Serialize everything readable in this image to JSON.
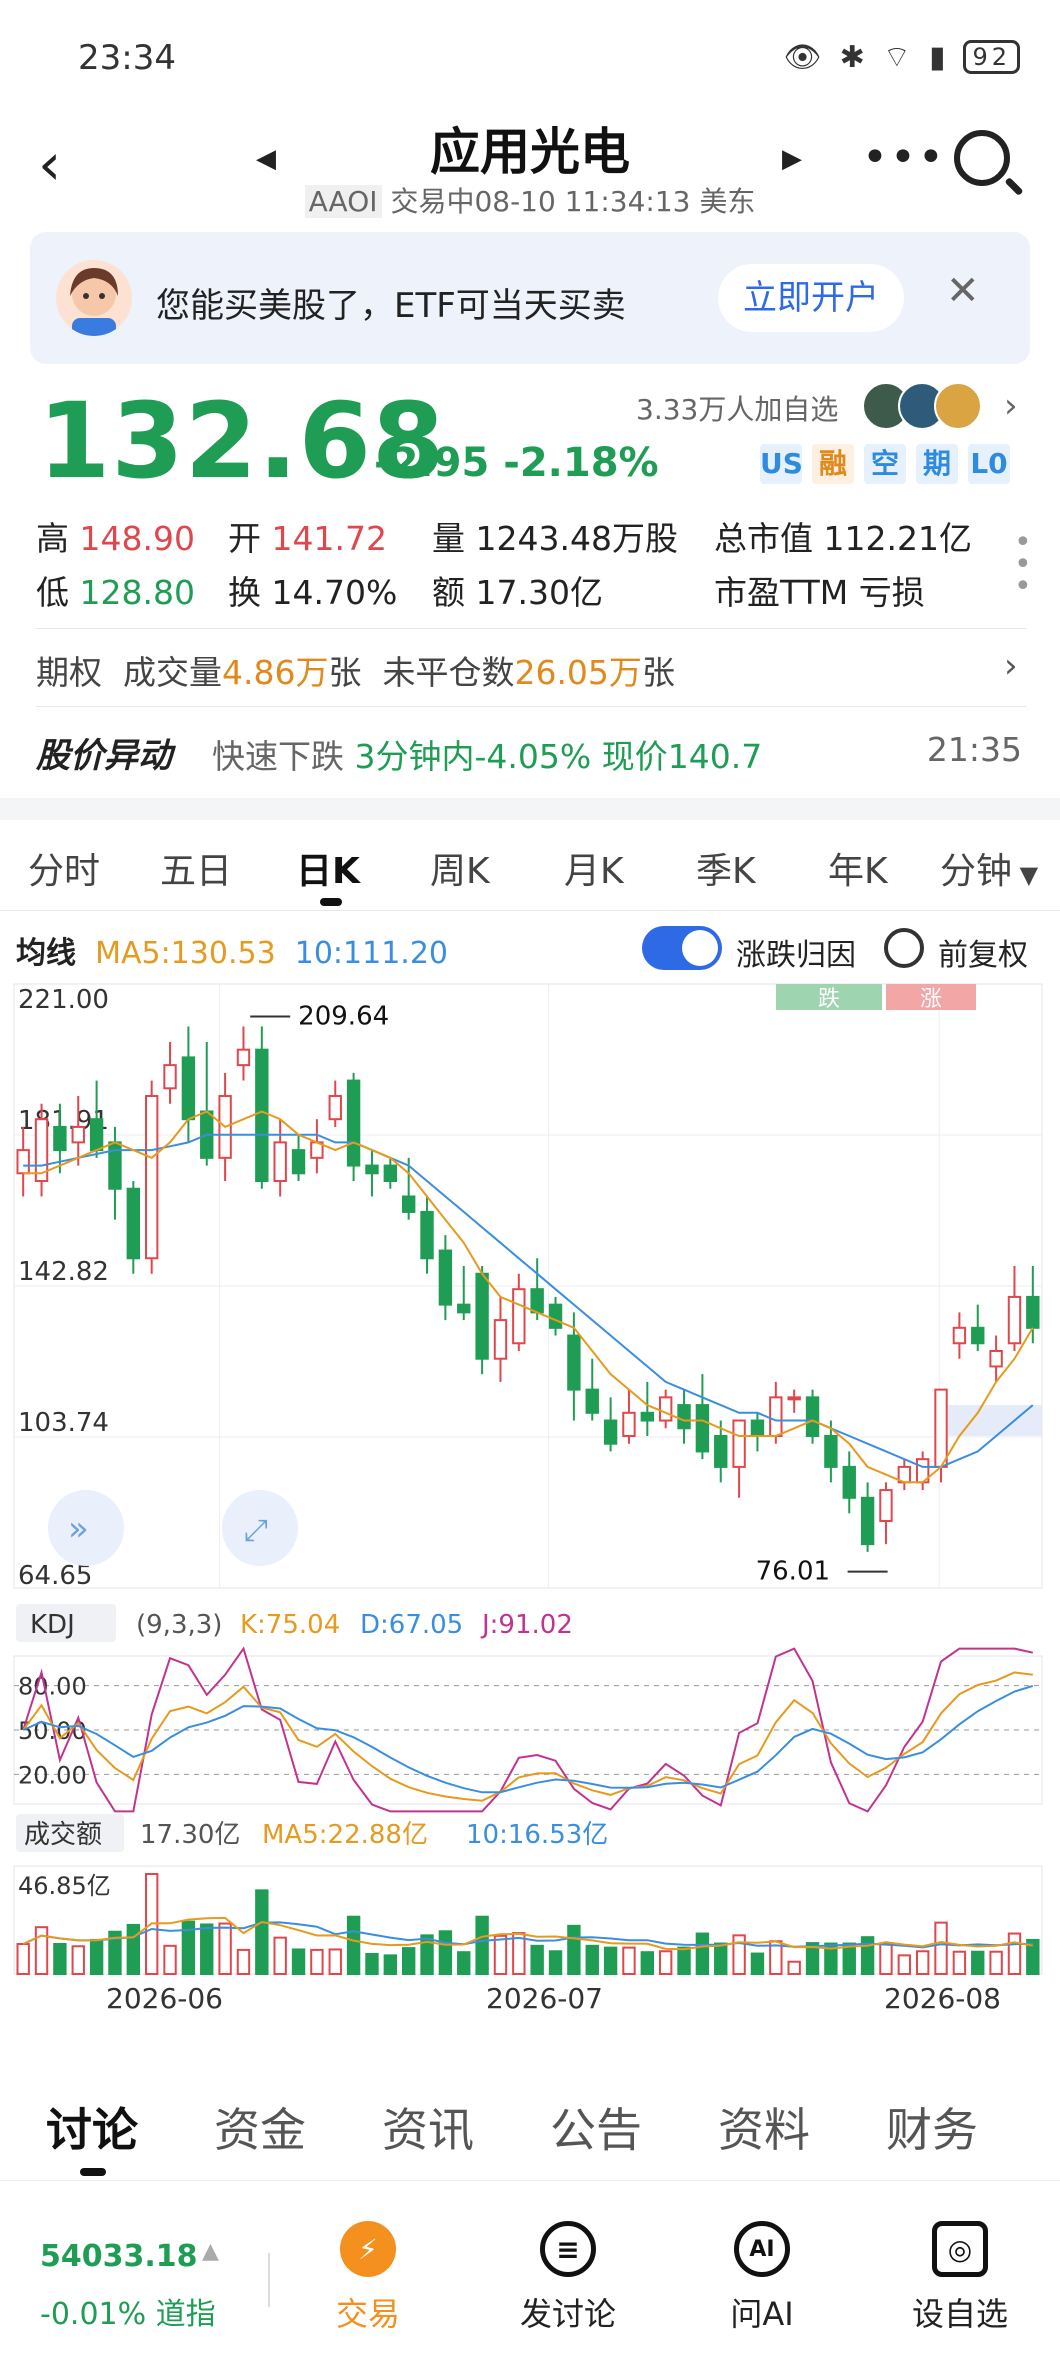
{
  "status": {
    "time": "23:34",
    "battery": "92",
    "icons": [
      "shield-icon",
      "eye-icon",
      "alarm-icon",
      "bluetooth-icon",
      "vibrate-icon",
      "wifi-icon",
      "hd-icon",
      "signal-icon"
    ]
  },
  "header": {
    "title": "应用光电",
    "ticker": "AAOI",
    "status_line": "交易中08-10 11:34:13 美东"
  },
  "banner": {
    "text": "您能买美股了，ETF可当天买卖",
    "button": "立即开户"
  },
  "quote": {
    "price": "132.68",
    "change": "-2.95",
    "change_pct": "-2.18%",
    "watch_count": "3.33万人加自选",
    "tags": [
      "US",
      "融",
      "空",
      "期",
      "L0"
    ],
    "high_label": "高",
    "high": "148.90",
    "open_label": "开",
    "open": "141.72",
    "volume_label": "量",
    "volume": "1243.48万股",
    "mcap_label": "总市值",
    "mcap": "112.21亿",
    "low_label": "低",
    "low": "128.80",
    "turnover_label": "换",
    "turnover": "14.70%",
    "amount_label": "额",
    "amount": "17.30亿",
    "pe_label": "市盈TTM",
    "pe": "亏损"
  },
  "options": {
    "label": "期权",
    "vol_label": "成交量",
    "vol": "4.86万",
    "vol_unit": "张",
    "oi_label": "未平仓数",
    "oi": "26.05万",
    "oi_unit": "张"
  },
  "alert": {
    "title": "股价异动",
    "type": "快速下跌",
    "detail": "3分钟内-4.05%",
    "price_text": "现价140.7",
    "time": "21:35"
  },
  "period_tabs": [
    "分时",
    "五日",
    "日K",
    "周K",
    "月K",
    "季K",
    "年K",
    "分钟"
  ],
  "ma": {
    "label": "均线",
    "ma5": "MA5:130.53",
    "ma10": "10:111.20"
  },
  "toggle_label": "涨跌归因",
  "fq_label": "前复权",
  "chart_data": {
    "type": "candlestick",
    "ylim": [
      64.65,
      221.0
    ],
    "y_ticks": [
      "221.00",
      "181.91",
      "142.82",
      "103.74",
      "64.65"
    ],
    "x_labels": [
      "2026-06",
      "2026-07",
      "2026-08"
    ],
    "annotations": {
      "high": "209.64",
      "low": "76.01"
    },
    "legend_badges": [
      "跌",
      "涨"
    ],
    "candles": [
      [
        172,
        178,
        166,
        184
      ],
      [
        170,
        186,
        166,
        190
      ],
      [
        184,
        178,
        172,
        190
      ],
      [
        180,
        184,
        174,
        192
      ],
      [
        186,
        178,
        176,
        196
      ],
      [
        180,
        168,
        160,
        184
      ],
      [
        168,
        150,
        146,
        170
      ],
      [
        150,
        192,
        146,
        196
      ],
      [
        194,
        200,
        190,
        206
      ],
      [
        202,
        186,
        180,
        210
      ],
      [
        188,
        176,
        174,
        206
      ],
      [
        176,
        192,
        170,
        198
      ],
      [
        200,
        204,
        196,
        210
      ],
      [
        204,
        170,
        168,
        210
      ],
      [
        170,
        180,
        166,
        186
      ],
      [
        178,
        172,
        170,
        182
      ],
      [
        176,
        180,
        172,
        186
      ],
      [
        186,
        192,
        184,
        196
      ],
      [
        196,
        174,
        170,
        198
      ],
      [
        174,
        172,
        166,
        178
      ],
      [
        174,
        170,
        168,
        176
      ],
      [
        166,
        162,
        160,
        176
      ],
      [
        162,
        150,
        146,
        166
      ],
      [
        152,
        138,
        134,
        156
      ],
      [
        138,
        136,
        134,
        148
      ],
      [
        146,
        124,
        120,
        148
      ],
      [
        124,
        134,
        118,
        140
      ],
      [
        128,
        142,
        126,
        146
      ],
      [
        142,
        136,
        134,
        150
      ],
      [
        138,
        132,
        130,
        140
      ],
      [
        130,
        116,
        108,
        136
      ],
      [
        116,
        110,
        108,
        124
      ],
      [
        108,
        102,
        100,
        114
      ],
      [
        104,
        110,
        102,
        116
      ],
      [
        110,
        108,
        104,
        118
      ],
      [
        108,
        114,
        106,
        116
      ],
      [
        112,
        106,
        102,
        116
      ],
      [
        112,
        100,
        98,
        120
      ],
      [
        104,
        96,
        92,
        108
      ],
      [
        96,
        108,
        88,
        108
      ],
      [
        108,
        104,
        100,
        110
      ],
      [
        104,
        114,
        102,
        118
      ],
      [
        114,
        114,
        110,
        116
      ],
      [
        114,
        104,
        102,
        116
      ],
      [
        104,
        96,
        92,
        108
      ],
      [
        96,
        88,
        84,
        100
      ],
      [
        88,
        76,
        74,
        92
      ],
      [
        82,
        90,
        76,
        92
      ],
      [
        92,
        96,
        90,
        98
      ],
      [
        92,
        98,
        90,
        100
      ],
      [
        96,
        116,
        92,
        116
      ],
      [
        128,
        132,
        124,
        136
      ],
      [
        132,
        128,
        126,
        138
      ],
      [
        122,
        126,
        118,
        130
      ],
      [
        128,
        140,
        126,
        148
      ],
      [
        140,
        132,
        128,
        148
      ]
    ],
    "ma5": [
      172,
      172,
      174,
      176,
      178,
      180,
      178,
      176,
      180,
      186,
      188,
      184,
      186,
      188,
      186,
      182,
      180,
      178,
      180,
      178,
      176,
      172,
      166,
      160,
      154,
      146,
      140,
      138,
      136,
      134,
      132,
      126,
      120,
      116,
      112,
      110,
      108,
      108,
      106,
      104,
      104,
      104,
      106,
      108,
      106,
      102,
      96,
      94,
      92,
      92,
      96,
      104,
      110,
      118,
      124,
      132
    ],
    "ma10": [
      174,
      174,
      175,
      176,
      177,
      178,
      178,
      178,
      179,
      180,
      182,
      182,
      182,
      182,
      182,
      182,
      182,
      180,
      180,
      178,
      176,
      174,
      170,
      166,
      162,
      158,
      154,
      150,
      146,
      142,
      138,
      134,
      130,
      126,
      122,
      118,
      116,
      114,
      112,
      110,
      110,
      108,
      108,
      108,
      106,
      104,
      102,
      100,
      98,
      96,
      96,
      98,
      100,
      104,
      108,
      112
    ]
  },
  "kdj": {
    "label": "KDJ",
    "params": "(9,3,3)",
    "k": "K:75.04",
    "d": "D:67.05",
    "j": "J:91.02",
    "levels": [
      "80.00",
      "50.00",
      "20.00"
    ]
  },
  "turnover_panel": {
    "label": "成交额",
    "value": "17.30亿",
    "ma5": "MA5:22.88亿",
    "ma10": "10:16.53亿",
    "max": "46.85亿"
  },
  "lower_tabs": [
    "讨论",
    "资金",
    "资讯",
    "公告",
    "资料",
    "财务"
  ],
  "index": {
    "value": "54033.18",
    "change": "-0.01%",
    "name": "道指"
  },
  "bottom_actions": [
    {
      "label": "交易",
      "icon": "trade-icon"
    },
    {
      "label": "发讨论",
      "icon": "post-icon"
    },
    {
      "label": "问AI",
      "icon": "ai-icon"
    },
    {
      "label": "设自选",
      "icon": "add-watch-icon"
    }
  ]
}
